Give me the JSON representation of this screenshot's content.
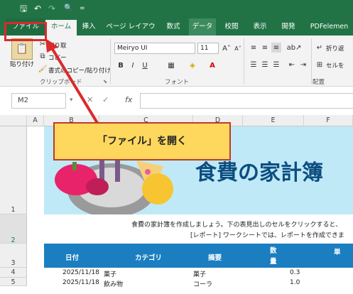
{
  "quick_access": {
    "save": "🖫",
    "undo": "↶",
    "redo": "↷",
    "preview": "🔍",
    "more": "="
  },
  "tabs": [
    "ファイル",
    "ホーム",
    "挿入",
    "ページ レイアウト",
    "数式",
    "データ",
    "校閲",
    "表示",
    "開発",
    "PDFelemen"
  ],
  "ribbon": {
    "paste_label": "貼り付け",
    "cut_label": "切り取",
    "copy_label": "コピー",
    "format_painter_label": "書式のコピー/貼り付け",
    "clipboard_group": "クリップボード",
    "font_name": "Meiryo UI",
    "font_size": "11",
    "font_group": "フォント",
    "bold": "B",
    "italic": "I",
    "underline": "U",
    "wrap_label": "折り返",
    "merge_label": "セルを",
    "align_group": "配置"
  },
  "formula_bar": {
    "name_box": "M2",
    "fx": "fx",
    "value": ""
  },
  "columns": [
    "A",
    "B",
    "C",
    "D",
    "E",
    "F"
  ],
  "rows": [
    "1",
    "2",
    "3",
    "4",
    "5"
  ],
  "banner": {
    "title": "食費の家計簿"
  },
  "instructions": [
    "食費の家計簿を作成しましょう。下の表見出しのセルをクリックすると、",
    "[レポート] ワークシートでは、レポートを作成できま"
  ],
  "table": {
    "headers": [
      "日付",
      "カテゴリ",
      "摘要",
      "数量",
      "単"
    ],
    "rows": [
      {
        "date": "2025/11/18",
        "category": "菓子",
        "desc": "菓子",
        "qty": "0.3"
      },
      {
        "date": "2025/11/18",
        "category": "飲み物",
        "desc": "コーラ",
        "qty": "1.0"
      }
    ]
  },
  "callout": {
    "text": "「ファイル」を開く"
  },
  "colors": {
    "excel_green": "#217346",
    "table_blue": "#1b7ec0",
    "banner_bg": "#bfe9f7",
    "callout_bg": "#fdd85d",
    "highlight_red": "#d92b2b"
  }
}
